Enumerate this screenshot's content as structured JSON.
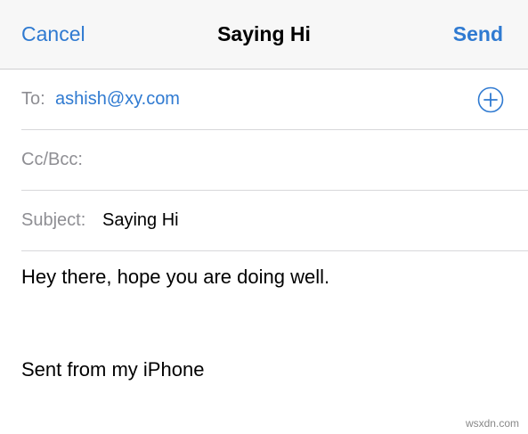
{
  "navbar": {
    "cancel_label": "Cancel",
    "title": "Saying Hi",
    "send_label": "Send"
  },
  "to": {
    "label": "To:",
    "value": "ashish@xy.com",
    "add_icon": "plus-circle-icon"
  },
  "cc": {
    "label": "Cc/Bcc:",
    "value": ""
  },
  "subject": {
    "label": "Subject:",
    "value": "Saying Hi"
  },
  "message": {
    "line1": "Hey there, hope you are doing well.",
    "signature": "Sent from my iPhone"
  },
  "watermark": "wsxdn.com",
  "colors": {
    "accent": "#2f7ad1",
    "label_gray": "#8e8e93",
    "navbar_bg": "#f7f7f7",
    "separator": "#d8d8da"
  }
}
